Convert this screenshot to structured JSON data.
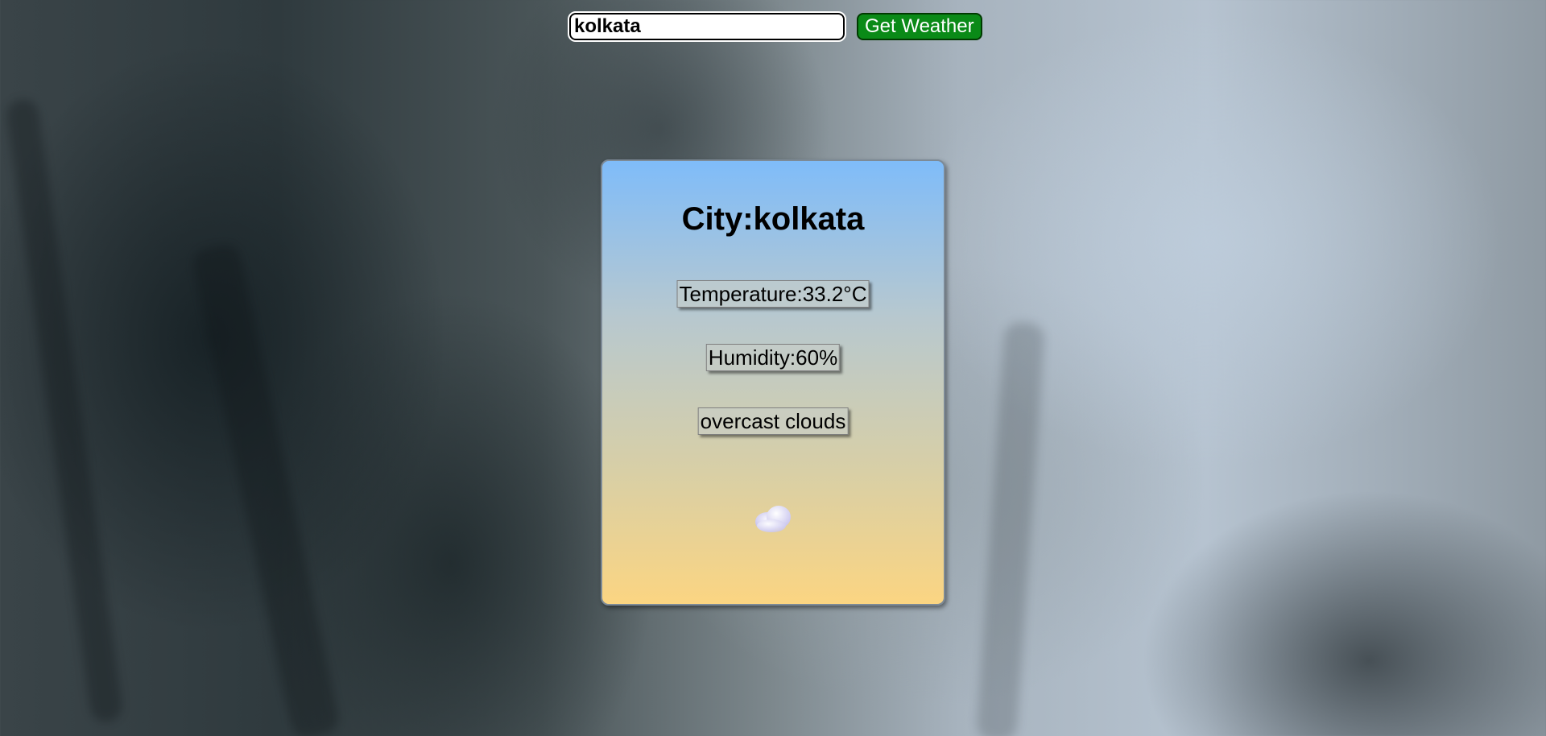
{
  "search": {
    "value": "kolkata",
    "button_label": "Get Weather"
  },
  "card": {
    "city_prefix": "City:",
    "city_name": "kolkata",
    "temperature": "Temperature:33.2°C",
    "humidity": "Humidity:60%",
    "description": "overcast clouds",
    "icon": "overcast-clouds-icon"
  },
  "colors": {
    "button_bg": "#0a8a17",
    "card_top": "#7fbcf9",
    "card_bottom": "#fbd582"
  }
}
